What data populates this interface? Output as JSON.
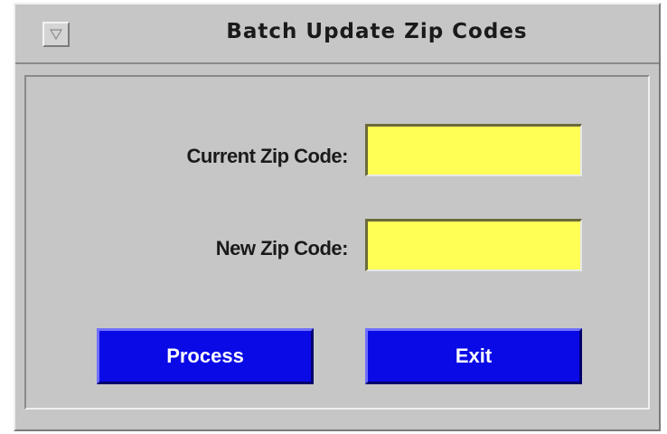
{
  "window": {
    "title": "Batch Update Zip Codes",
    "menu_icon": "triangle-down-icon"
  },
  "form": {
    "current_zip_label": "Current Zip Code:",
    "current_zip_value": "",
    "new_zip_label": "New Zip Code:",
    "new_zip_value": ""
  },
  "buttons": {
    "process_label": "Process",
    "exit_label": "Exit"
  },
  "colors": {
    "field_background": "#ffff55",
    "button_background": "#0a0ae6",
    "window_background": "#c6c6c6"
  }
}
